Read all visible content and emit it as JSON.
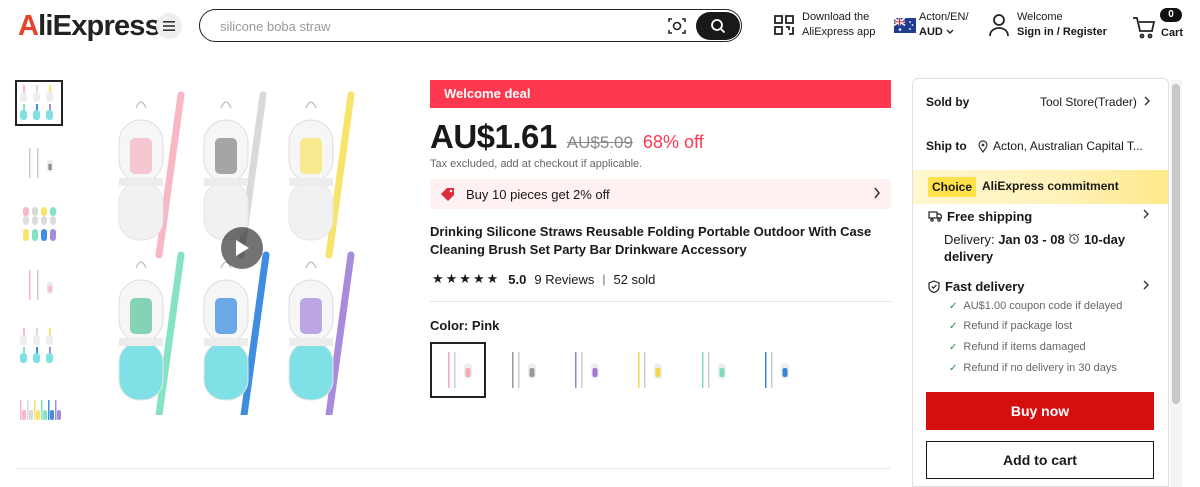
{
  "header": {
    "logo_text": "AliExpress",
    "search_placeholder": "silicone boba straw",
    "download_line1": "Download the",
    "download_line2": "AliExpress app",
    "locale_line1": "Acton/EN/",
    "locale_line2": "AUD",
    "account_line1": "Welcome",
    "account_line2": "Sign in / Register",
    "cart_count": "0",
    "cart_label": "Cart"
  },
  "gallery": {
    "thumbnails": [
      "thumb-pink",
      "thumb-white",
      "thumb-multi-a",
      "thumb-pink-b",
      "thumb-multi-b",
      "thumb-set"
    ],
    "straw_colors": [
      "#f7b7c4",
      "#d9d9d9",
      "#f7e46b",
      "#86e3c2",
      "#3e8de0",
      "#a98bde"
    ],
    "case_color_top": "#f1f1f1",
    "case_color_bottom": "#7fe0e6"
  },
  "product": {
    "deal_banner": "Welcome deal",
    "price": "AU$1.61",
    "old_price": "AU$5.09",
    "discount": "68% off",
    "tax_note": "Tax excluded, add at checkout if applicable.",
    "bundle_offer": "Buy 10 pieces get 2% off",
    "title": "Drinking Silicone Straws Reusable Folding Portable Outdoor With Case Cleaning Brush Set Party Bar Drinkware Accessory",
    "rating": "5.0",
    "reviews": "9 Reviews",
    "sold": "52 sold",
    "color_label": "Color:",
    "color_value": "Pink",
    "swatches": [
      {
        "name": "Pink",
        "color": "#f5a8b8"
      },
      {
        "name": "Gray",
        "color": "#9a9a9a"
      },
      {
        "name": "Purple",
        "color": "#a07ad6"
      },
      {
        "name": "Yellow",
        "color": "#f2d64b"
      },
      {
        "name": "Green",
        "color": "#7fdcb6"
      },
      {
        "name": "Blue",
        "color": "#3b86d8"
      }
    ]
  },
  "panel": {
    "sold_by_label": "Sold by",
    "store_name": "Tool Store(Trader)",
    "ship_to_label": "Ship to",
    "ship_to_value": "Acton, Australian Capital T...",
    "choice_tag": "Choice",
    "commitment": "AliExpress commitment",
    "free_shipping": "Free shipping",
    "delivery_label": "Delivery:",
    "delivery_dates": "Jan 03 - 08",
    "delivery_days": "10-day delivery",
    "fast_delivery": "Fast delivery",
    "guarantees": [
      "AU$1.00 coupon code if delayed",
      "Refund if package lost",
      "Refund if items damaged",
      "Refund if no delivery in 30 days"
    ],
    "buy_now": "Buy now",
    "add_to_cart": "Add to cart"
  },
  "colors": {
    "accent_red": "#fd384f",
    "buy_red": "#d50e0e",
    "choice_yellow": "#ffe24a"
  }
}
